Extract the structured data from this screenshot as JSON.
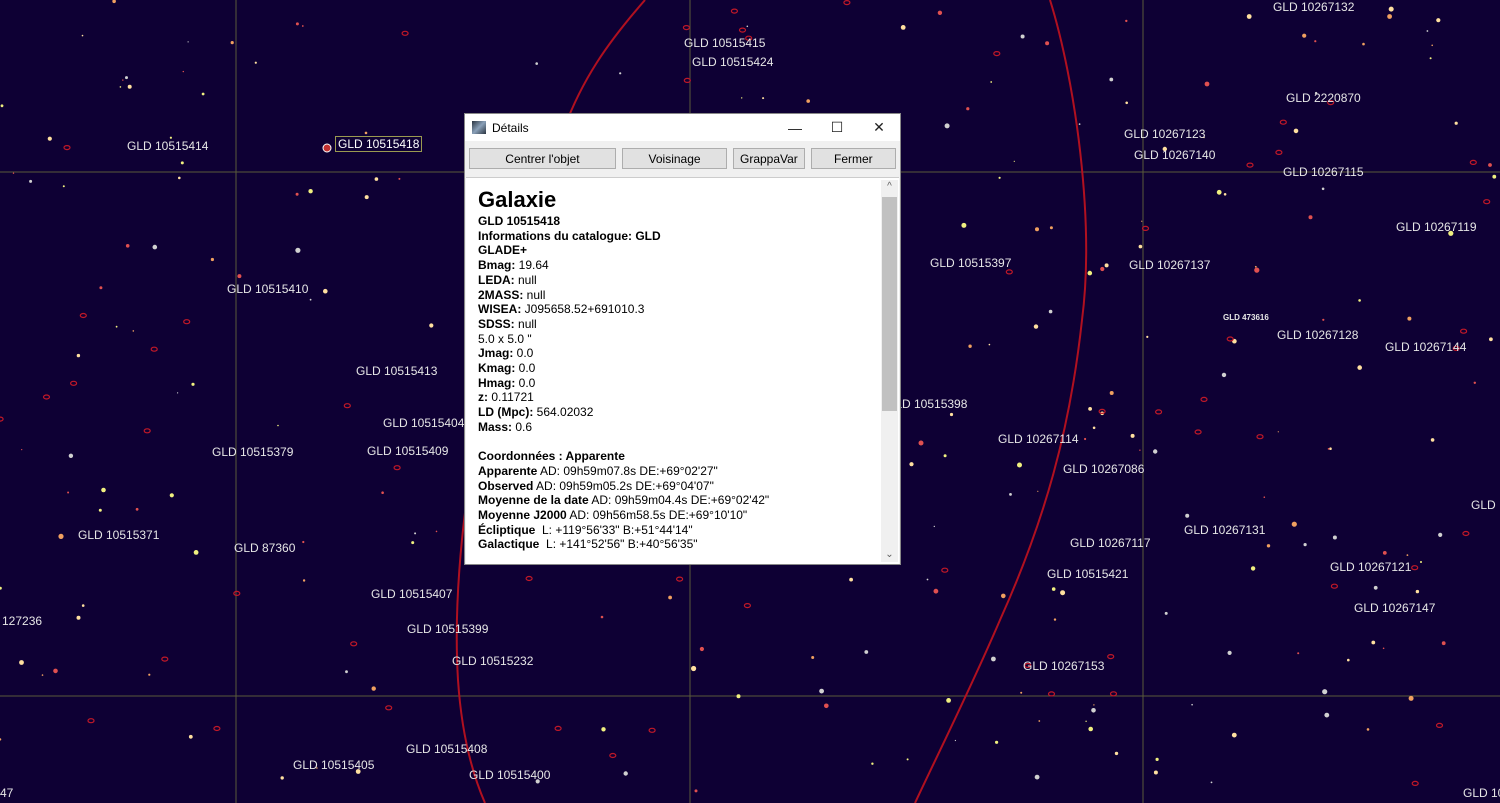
{
  "sky_labels": [
    "GLD 10515415",
    "GLD 10515424",
    "GLD 10267132",
    "GLD 2220870",
    "GLD 10267123",
    "GLD 10267140",
    "GLD 10267115",
    "GLD 10267119",
    "GLD 10515414",
    "GLD 10515418",
    "GLD 10515397",
    "GLD 10267137",
    "GLD 473616",
    "GLD 10267128",
    "GLD 10267144",
    "GLD 10515410",
    "GLD 10515413",
    "GLD 10515398",
    "GLD 10515404",
    "GLD 10267114",
    "GLD 10515379",
    "GLD 10515409",
    "GLD 10267086",
    "GLD",
    "GLD 10515371",
    "GLD 87360",
    "GLD 10267131",
    "GLD 10267117",
    "GLD 10515421",
    "GLD 10267121",
    "GLD 10515407",
    "GLD 10267147",
    "127236",
    "GLD 10515399",
    "GLD 10515232",
    "GLD 10267153",
    "GLD 10515408",
    "GLD 10515405",
    "GLD 10515400",
    "GLD 10",
    "47"
  ],
  "dialog": {
    "title": "Détails",
    "buttons": [
      "Centrer l'objet",
      "Voisinage",
      "GrappaVar",
      "Fermer"
    ],
    "heading": "Galaxie",
    "name": "GLD 10515418",
    "catalog": "Informations du catalogue: GLD",
    "catalog_name": "GLADE+",
    "fields": [
      {
        "k": "Bmag:",
        "v": " 19.64"
      },
      {
        "k": "LEDA:",
        "v": " null"
      },
      {
        "k": "2MASS:",
        "v": " null"
      },
      {
        "k": "WISEA:",
        "v": " J095658.52+691010.3"
      },
      {
        "k": "SDSS:",
        "v": " null"
      },
      {
        "k": "",
        "v": "5.0 x 5.0 \""
      },
      {
        "k": "Jmag:",
        "v": " 0.0"
      },
      {
        "k": "Kmag:",
        "v": " 0.0"
      },
      {
        "k": "Hmag:",
        "v": " 0.0"
      },
      {
        "k": "z:",
        "v": " 0.11721"
      },
      {
        "k": "LD (Mpc):",
        "v": " 564.02032"
      },
      {
        "k": "Mass:",
        "v": " 0.6"
      }
    ],
    "coords_title": "Coordonnées : Apparente",
    "coords": [
      {
        "k": "Apparente",
        "v": " AD: 09h59m07.8s DE:+69°02'27\""
      },
      {
        "k": "Observed",
        "v": " AD: 09h59m05.2s DE:+69°04'07\""
      },
      {
        "k": "Moyenne de la date",
        "v": " AD: 09h59m04.4s DE:+69°02'42\""
      },
      {
        "k": "Moyenne J2000",
        "v": " AD: 09h56m58.5s DE:+69°10'10\""
      },
      {
        "k": "Écliptique",
        "v": "  L: +119°56'33\" B:+51°44'14\""
      },
      {
        "k": "Galactique",
        "v": "  L: +141°52'56\" B:+40°56'35\""
      }
    ]
  }
}
